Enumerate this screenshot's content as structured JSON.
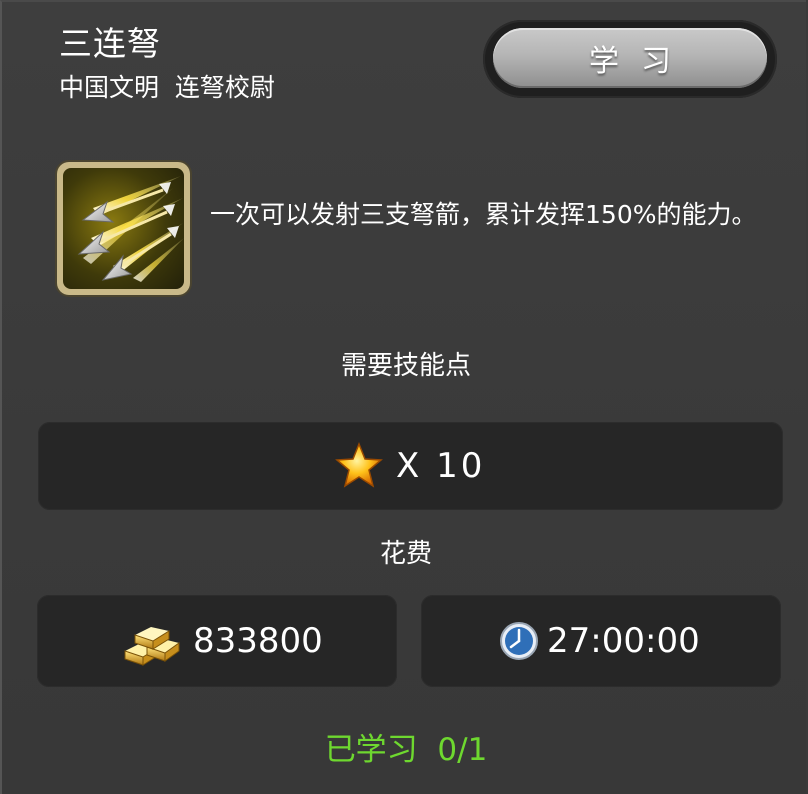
{
  "skill": {
    "name": "三连弩",
    "subtitle": "中国文明  连弩校尉",
    "description": "一次可以发射三支弩箭，累计发挥150%的能力。",
    "icon": "triple-crossbow-arrows-icon"
  },
  "learn_button": {
    "label": "学习"
  },
  "requirements": {
    "skill_points_label": "需要技能点",
    "skill_points_value": "X 10",
    "skill_points_icon": "star-icon",
    "cost_label": "花费",
    "gold_value": "833800",
    "gold_icon": "gold-bars-icon",
    "time_value": "27:00:00",
    "time_icon": "clock-icon"
  },
  "status": {
    "learned_text": "已学习  0/1"
  },
  "colors": {
    "background": "#3a3a3a",
    "box": "#262626",
    "status_green": "#6ed82f",
    "button_gray": "#b5b5b5",
    "icon_frame": "#c9b989"
  }
}
